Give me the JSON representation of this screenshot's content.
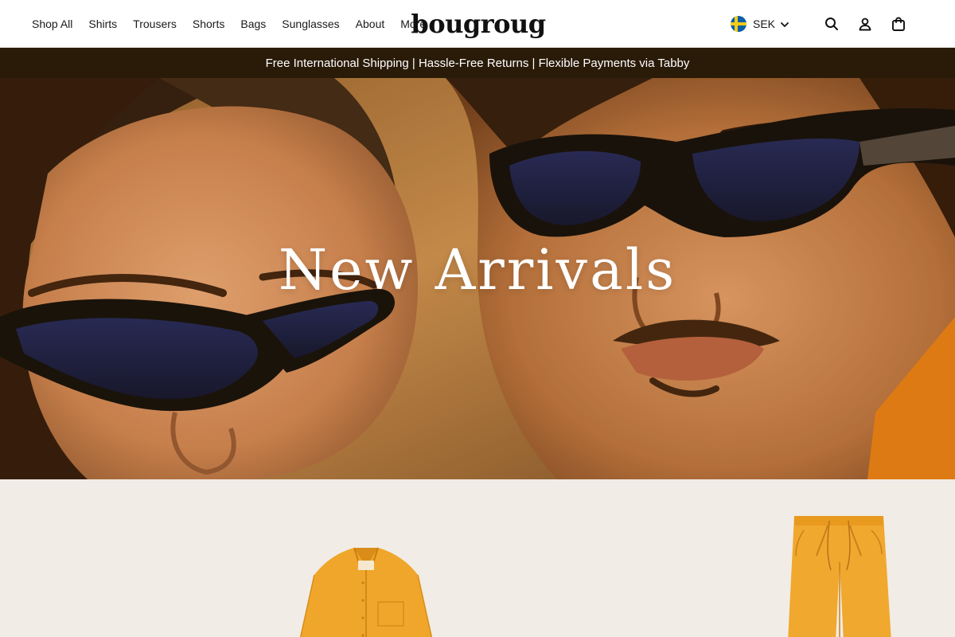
{
  "nav": {
    "items": [
      {
        "label": "Shop All"
      },
      {
        "label": "Shirts"
      },
      {
        "label": "Trousers"
      },
      {
        "label": "Shorts"
      },
      {
        "label": "Bags"
      },
      {
        "label": "Sunglasses"
      },
      {
        "label": "About"
      },
      {
        "label": "More"
      }
    ]
  },
  "brand": {
    "name": "bougroug"
  },
  "currency": {
    "code": "SEK",
    "flag": "sweden-flag"
  },
  "tools": {
    "search_icon": "search-icon",
    "account_icon": "account-icon",
    "cart_icon": "bag-icon"
  },
  "announcement": {
    "text": "Free International Shipping | Hassle-Free Returns | Flexible Payments via Tabby"
  },
  "hero": {
    "title": "New Arrivals"
  },
  "colors": {
    "announcement_bg": "#2a1b09",
    "product_area_bg": "#f1ece6",
    "product_orange": "#f0a62a"
  }
}
